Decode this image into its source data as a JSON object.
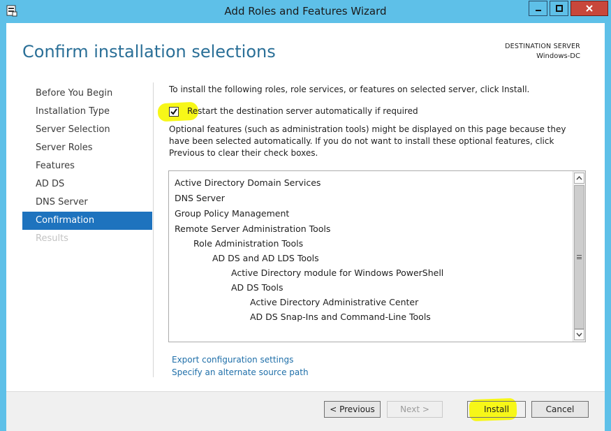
{
  "window": {
    "title": "Add Roles and Features Wizard"
  },
  "header": {
    "page_title": "Confirm installation selections",
    "destination_label": "DESTINATION SERVER",
    "destination_value": "Windows-DC"
  },
  "nav": {
    "items": [
      {
        "label": "Before You Begin",
        "state": "normal"
      },
      {
        "label": "Installation Type",
        "state": "normal"
      },
      {
        "label": "Server Selection",
        "state": "normal"
      },
      {
        "label": "Server Roles",
        "state": "normal"
      },
      {
        "label": "Features",
        "state": "normal"
      },
      {
        "label": "AD DS",
        "state": "normal"
      },
      {
        "label": "DNS Server",
        "state": "normal"
      },
      {
        "label": "Confirmation",
        "state": "active"
      },
      {
        "label": "Results",
        "state": "disabled"
      }
    ]
  },
  "main": {
    "intro": "To install the following roles, role services, or features on selected server, click Install.",
    "restart_label": "Restart the destination server automatically if required",
    "restart_checked": true,
    "optional_text": "Optional features (such as administration tools) might be displayed on this page because they have been selected automatically. If you do not want to install these optional features, click Previous to clear their check boxes.",
    "items": [
      {
        "label": "Active Directory Domain Services",
        "level": 0
      },
      {
        "label": "DNS Server",
        "level": 0
      },
      {
        "label": "Group Policy Management",
        "level": 0
      },
      {
        "label": "Remote Server Administration Tools",
        "level": 0
      },
      {
        "label": "Role Administration Tools",
        "level": 1
      },
      {
        "label": "AD DS and AD LDS Tools",
        "level": 2
      },
      {
        "label": "Active Directory module for Windows PowerShell",
        "level": 3
      },
      {
        "label": "AD DS Tools",
        "level": 3
      },
      {
        "label": "Active Directory Administrative Center",
        "level": 4
      },
      {
        "label": "AD DS Snap-Ins and Command-Line Tools",
        "level": 4
      }
    ],
    "export_link": "Export configuration settings",
    "alternate_link": "Specify an alternate source path"
  },
  "footer": {
    "previous_label": "< Previous",
    "next_label": "Next >",
    "install_label": "Install",
    "cancel_label": "Cancel"
  },
  "colors": {
    "titlebar": "#5ec0e8",
    "accent": "#1e73be",
    "title_text": "#2a6f97",
    "link": "#1f6fa9",
    "highlight": "#f7f718",
    "close_button": "#c8473b"
  }
}
